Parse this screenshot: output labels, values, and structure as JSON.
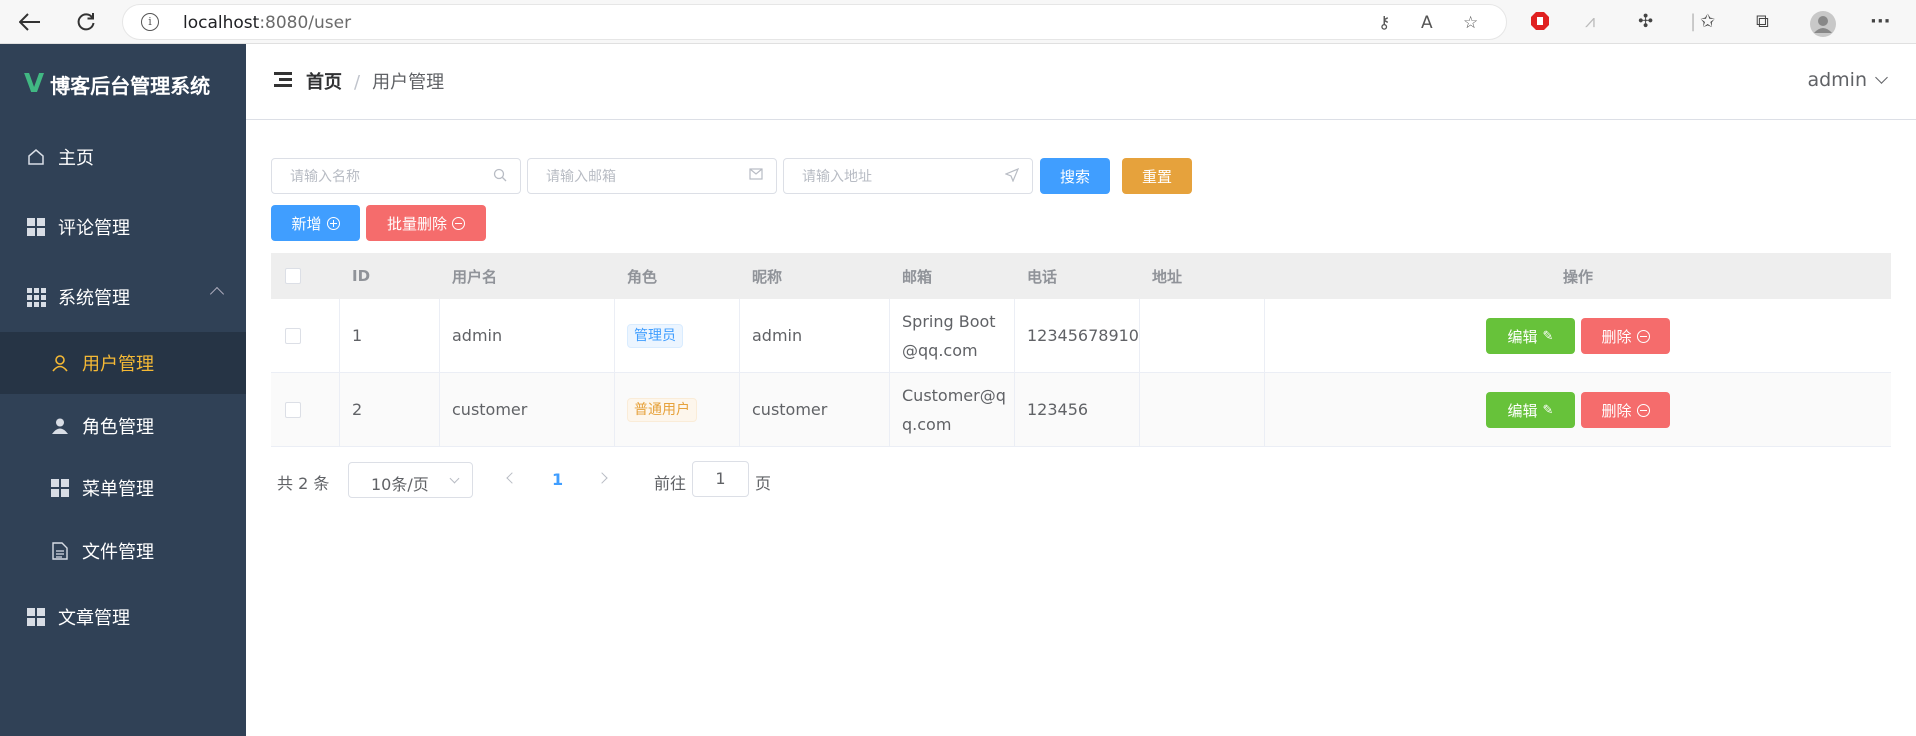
{
  "browser": {
    "url_host": "localhost",
    "url_path": ":8080/user",
    "back_icon": "back-arrow-icon",
    "refresh_icon": "refresh-icon"
  },
  "sidebar": {
    "logo_mark": "V",
    "title": "博客后台管理系统",
    "items": [
      {
        "label": "主页",
        "icon": "home-icon"
      },
      {
        "label": "评论管理",
        "icon": "grid-icon"
      },
      {
        "label": "系统管理",
        "icon": "apps-icon",
        "expanded": true
      },
      {
        "label": "用户管理",
        "icon": "user-icon",
        "active": true
      },
      {
        "label": "角色管理",
        "icon": "person-icon"
      },
      {
        "label": "菜单管理",
        "icon": "grid-icon"
      },
      {
        "label": "文件管理",
        "icon": "document-icon"
      },
      {
        "label": "文章管理",
        "icon": "grid-icon"
      }
    ]
  },
  "header": {
    "breadcrumb_home": "首页",
    "breadcrumb_sep": "/",
    "breadcrumb_current": "用户管理",
    "user": "admin"
  },
  "search": {
    "name_placeholder": "请输入名称",
    "email_placeholder": "请输入邮箱",
    "address_placeholder": "请输入地址",
    "search_label": "搜索",
    "reset_label": "重置",
    "add_label": "新增",
    "batch_delete_label": "批量删除"
  },
  "table": {
    "columns": [
      "ID",
      "用户名",
      "角色",
      "昵称",
      "邮箱",
      "电话",
      "地址",
      "操作"
    ],
    "rows": [
      {
        "id": "1",
        "username": "admin",
        "role": "管理员",
        "nickname": "admin",
        "email": "Spring Boot@qq.com",
        "phone": "12345678910",
        "address": ""
      },
      {
        "id": "2",
        "username": "customer",
        "role": "普通用户",
        "nickname": "customer",
        "email": "Customer@qq.com",
        "phone": "123456",
        "address": ""
      }
    ],
    "edit_label": "编辑",
    "delete_label": "删除"
  },
  "pagination": {
    "total_text": "共 2 条",
    "page_size": "10条/页",
    "current_page": "1",
    "goto_prefix": "前往",
    "goto_value": "1",
    "goto_suffix": "页"
  },
  "colors": {
    "sidebar_bg": "#304156",
    "active_item": "#f5b935",
    "primary": "#409eff",
    "warning": "#e6a23c",
    "danger": "#f56c6c",
    "success": "#67c23a"
  }
}
